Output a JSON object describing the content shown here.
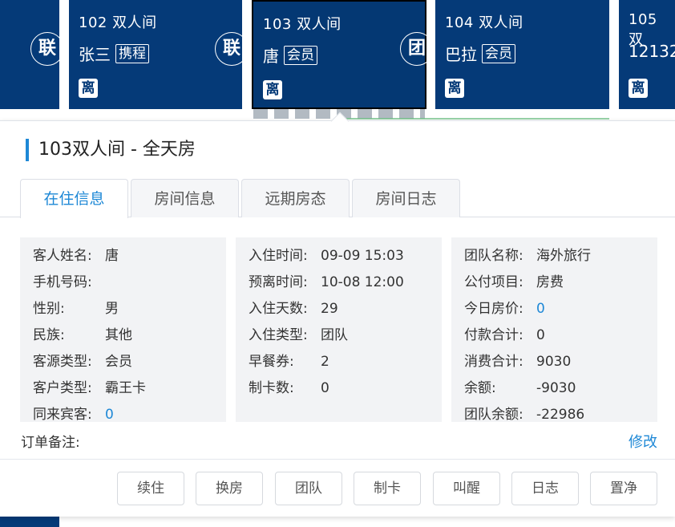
{
  "cards": [
    {
      "title": "",
      "guest": "",
      "tag": "",
      "leave": ""
    },
    {
      "title": "102 双人间",
      "guest": "张三",
      "tag": "携程",
      "leave": "离"
    },
    {
      "title": "103 双人间",
      "guest": "唐",
      "tag": "会员",
      "leave": "离"
    },
    {
      "title": "104 双人间",
      "guest": "巴拉",
      "tag": "会员",
      "leave": "离"
    },
    {
      "title": "105 双",
      "guest": "12132",
      "tag": "",
      "leave": "离"
    }
  ],
  "badges": [
    "联",
    "联",
    "团"
  ],
  "panel": {
    "title": "103双人间 - 全天房",
    "tabs": [
      "在住信息",
      "房间信息",
      "远期房态",
      "房间日志"
    ],
    "columns": [
      [
        {
          "k": "客人姓名:",
          "v": "唐"
        },
        {
          "k": "手机号码:",
          "v": ""
        },
        {
          "k": "性别:",
          "v": "男"
        },
        {
          "k": "民族:",
          "v": "其他"
        },
        {
          "k": "客源类型:",
          "v": "会员"
        },
        {
          "k": "客户类型:",
          "v": "霸王卡"
        },
        {
          "k": "同来宾客:",
          "v": "0"
        }
      ],
      [
        {
          "k": "入住时间:",
          "v": "09-09 15:03"
        },
        {
          "k": "预离时间:",
          "v": "10-08 12:00"
        },
        {
          "k": "入住天数:",
          "v": "29"
        },
        {
          "k": "入住类型:",
          "v": "团队"
        },
        {
          "k": "早餐券:",
          "v": "2"
        },
        {
          "k": "制卡数:",
          "v": "0"
        }
      ],
      [
        {
          "k": "团队名称:",
          "v": "海外旅行"
        },
        {
          "k": "公付项目:",
          "v": "房费"
        },
        {
          "k": "今日房价:",
          "v": "0"
        },
        {
          "k": "付款合计:",
          "v": "0"
        },
        {
          "k": "消费合计:",
          "v": "9030"
        },
        {
          "k": "余额:",
          "v": "-9030"
        },
        {
          "k": "团队余额:",
          "v": "-22986"
        }
      ]
    ],
    "remark_label": "订单备注:",
    "edit_label": "修改",
    "actions": [
      "续住",
      "换房",
      "团队",
      "制卡",
      "叫醒",
      "日志",
      "置净"
    ]
  },
  "colors": {
    "card_bg": "#053a78",
    "accent": "#1e88d6"
  }
}
